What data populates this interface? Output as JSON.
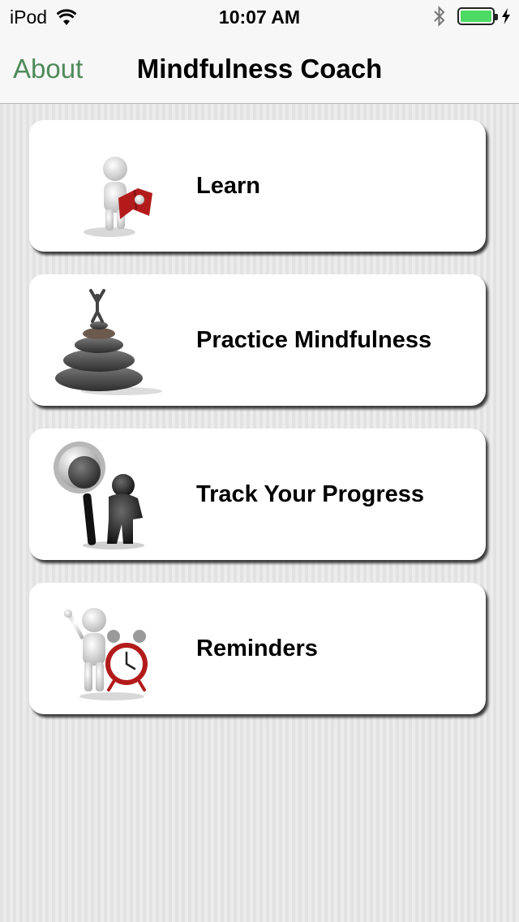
{
  "status_bar": {
    "carrier": "iPod",
    "time": "10:07 AM",
    "battery_color": "#4cd964"
  },
  "nav": {
    "back_label": "About",
    "title": "Mindfulness Coach",
    "back_color": "#4f8a5b"
  },
  "menu": {
    "items": [
      {
        "label": "Learn",
        "icon": "reading-figure-icon"
      },
      {
        "label": "Practice Mindfulness",
        "icon": "stacked-stones-icon"
      },
      {
        "label": "Track Your Progress",
        "icon": "magnifier-figure-icon"
      },
      {
        "label": "Reminders",
        "icon": "alarm-clock-figure-icon"
      }
    ]
  }
}
